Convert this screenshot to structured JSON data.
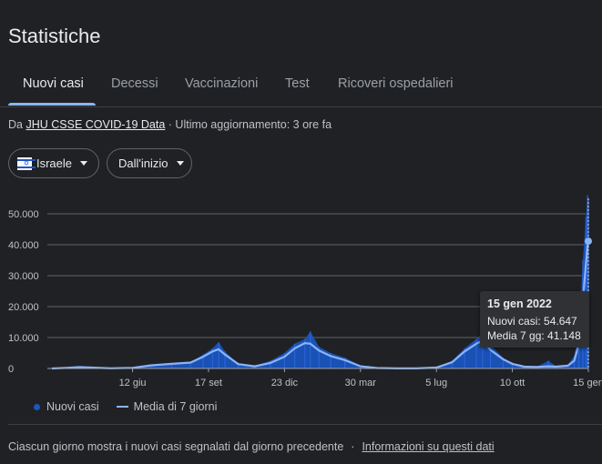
{
  "page_title": "Statistiche",
  "tabs": [
    {
      "label": "Nuovi casi",
      "active": true
    },
    {
      "label": "Decessi",
      "active": false
    },
    {
      "label": "Vaccinazioni",
      "active": false
    },
    {
      "label": "Test",
      "active": false
    },
    {
      "label": "Ricoveri ospedalieri",
      "active": false
    }
  ],
  "source": {
    "prefix": "Da",
    "link": "JHU CSSE COVID-19 Data",
    "updated": "· Ultimo aggiornamento: 3 ore fa"
  },
  "filters": {
    "country": "Israele",
    "range": "Dall'inizio"
  },
  "tooltip": {
    "date": "15 gen 2022",
    "line1": "Nuovi casi: 54.647",
    "line2": "Media 7 gg: 41.148"
  },
  "legend": {
    "cases": "Nuovi casi",
    "avg": "Media di 7 giorni"
  },
  "footer": {
    "text": "Ciascun giorno mostra i nuovi casi segnalati dal giorno precedente",
    "link": "Informazioni su questi dati"
  },
  "colors": {
    "bars": "#1a56c4",
    "average_line": "#8ab4f8",
    "background": "#202124"
  },
  "chart_data": {
    "type": "bar",
    "ylim": [
      0,
      55000
    ],
    "yticks": [
      0,
      10000,
      20000,
      30000,
      40000,
      50000
    ],
    "ytick_labels": [
      "0",
      "10.000",
      "20.000",
      "30.000",
      "40.000",
      "50.000"
    ],
    "xtick_labels": [
      "12 giu",
      "17 set",
      "23 dic",
      "30 mar",
      "5 lug",
      "10 ott",
      "15 gen"
    ],
    "xticks": [
      "2020-06-12",
      "2020-09-17",
      "2020-12-23",
      "2021-03-30",
      "2021-07-05",
      "2021-10-10",
      "2022-01-15"
    ],
    "xlim": [
      "2020-03-01",
      "2022-01-15"
    ],
    "series": [
      {
        "name": "Nuovi casi",
        "kind": "bars",
        "points": [
          [
            "2020-03-01",
            0
          ],
          [
            "2020-03-20",
            400
          ],
          [
            "2020-04-05",
            700
          ],
          [
            "2020-04-20",
            200
          ],
          [
            "2020-05-15",
            50
          ],
          [
            "2020-06-12",
            250
          ],
          [
            "2020-07-05",
            1300
          ],
          [
            "2020-08-01",
            1600
          ],
          [
            "2020-08-25",
            2000
          ],
          [
            "2020-09-10",
            4500
          ],
          [
            "2020-09-22",
            6500
          ],
          [
            "2020-09-30",
            8500
          ],
          [
            "2020-10-08",
            5500
          ],
          [
            "2020-10-25",
            1500
          ],
          [
            "2020-11-15",
            800
          ],
          [
            "2020-12-05",
            2500
          ],
          [
            "2020-12-23",
            5000
          ],
          [
            "2021-01-05",
            8000
          ],
          [
            "2021-01-18",
            9500
          ],
          [
            "2021-01-25",
            12000
          ],
          [
            "2021-02-05",
            7000
          ],
          [
            "2021-02-20",
            5000
          ],
          [
            "2021-03-10",
            3500
          ],
          [
            "2021-03-30",
            1000
          ],
          [
            "2021-04-20",
            200
          ],
          [
            "2021-05-15",
            40
          ],
          [
            "2021-06-10",
            30
          ],
          [
            "2021-07-05",
            400
          ],
          [
            "2021-07-25",
            2500
          ],
          [
            "2021-08-10",
            6500
          ],
          [
            "2021-08-25",
            9500
          ],
          [
            "2021-09-02",
            11500
          ],
          [
            "2021-09-12",
            7500
          ],
          [
            "2021-09-28",
            3500
          ],
          [
            "2021-10-10",
            1800
          ],
          [
            "2021-10-25",
            700
          ],
          [
            "2021-11-10",
            500
          ],
          [
            "2021-11-25",
            2500
          ],
          [
            "2021-12-05",
            700
          ],
          [
            "2021-12-20",
            1200
          ],
          [
            "2021-12-28",
            4000
          ],
          [
            "2022-01-03",
            12000
          ],
          [
            "2022-01-08",
            35000
          ],
          [
            "2022-01-12",
            49000
          ],
          [
            "2022-01-14",
            56000
          ],
          [
            "2022-01-15",
            54647
          ]
        ]
      },
      {
        "name": "Media di 7 giorni",
        "kind": "line",
        "points": [
          [
            "2020-03-01",
            0
          ],
          [
            "2020-03-20",
            200
          ],
          [
            "2020-04-05",
            450
          ],
          [
            "2020-04-20",
            300
          ],
          [
            "2020-05-15",
            50
          ],
          [
            "2020-06-12",
            200
          ],
          [
            "2020-07-05",
            1000
          ],
          [
            "2020-08-01",
            1500
          ],
          [
            "2020-08-25",
            1900
          ],
          [
            "2020-09-10",
            3800
          ],
          [
            "2020-09-22",
            5500
          ],
          [
            "2020-09-30",
            6200
          ],
          [
            "2020-10-08",
            4500
          ],
          [
            "2020-10-25",
            1400
          ],
          [
            "2020-11-15",
            700
          ],
          [
            "2020-12-05",
            1800
          ],
          [
            "2020-12-23",
            3800
          ],
          [
            "2021-01-05",
            6500
          ],
          [
            "2021-01-18",
            8200
          ],
          [
            "2021-01-25",
            8000
          ],
          [
            "2021-02-05",
            5800
          ],
          [
            "2021-02-20",
            4000
          ],
          [
            "2021-03-10",
            2700
          ],
          [
            "2021-03-30",
            700
          ],
          [
            "2021-04-20",
            150
          ],
          [
            "2021-05-15",
            30
          ],
          [
            "2021-06-10",
            30
          ],
          [
            "2021-07-05",
            300
          ],
          [
            "2021-07-25",
            2000
          ],
          [
            "2021-08-10",
            5500
          ],
          [
            "2021-08-25",
            8000
          ],
          [
            "2021-09-02",
            9000
          ],
          [
            "2021-09-12",
            6000
          ],
          [
            "2021-09-28",
            3000
          ],
          [
            "2021-10-10",
            1500
          ],
          [
            "2021-10-25",
            600
          ],
          [
            "2021-11-10",
            500
          ],
          [
            "2021-11-25",
            700
          ],
          [
            "2021-12-05",
            600
          ],
          [
            "2021-12-20",
            900
          ],
          [
            "2021-12-28",
            2500
          ],
          [
            "2022-01-03",
            8000
          ],
          [
            "2022-01-08",
            22000
          ],
          [
            "2022-01-12",
            34000
          ],
          [
            "2022-01-14",
            39500
          ],
          [
            "2022-01-15",
            41148
          ]
        ]
      }
    ],
    "highlight": {
      "date": "2022-01-15",
      "value": 41148
    }
  }
}
